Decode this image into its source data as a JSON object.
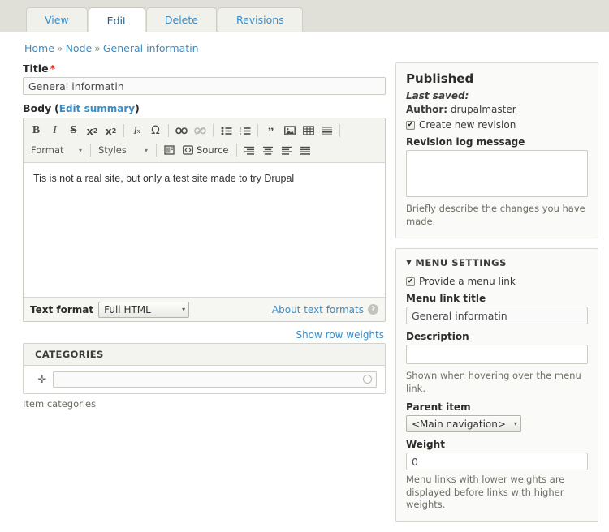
{
  "tabs": [
    {
      "label": "View",
      "active": false
    },
    {
      "label": "Edit",
      "active": true
    },
    {
      "label": "Delete",
      "active": false
    },
    {
      "label": "Revisions",
      "active": false
    }
  ],
  "breadcrumb": {
    "home": "Home",
    "node": "Node",
    "current": "General informatin",
    "separator": "»"
  },
  "form": {
    "title_label": "Title",
    "title_required_mark": "*",
    "title_value": "General informatin",
    "body_label": "Body",
    "body_edit_summary": "Edit summary",
    "body_paren_open": "(",
    "body_paren_close": ")",
    "body_text": "Tis is not a real site, but only a test site made to try Drupal"
  },
  "editor": {
    "format_dropdown": "Format",
    "styles_dropdown": "Styles",
    "source_label": "Source",
    "caret": "▾",
    "buttons_row1": [
      {
        "name": "bold-icon",
        "glyph": "B"
      },
      {
        "name": "italic-icon",
        "glyph": "I"
      },
      {
        "name": "strikethrough-icon",
        "glyph": "S"
      },
      {
        "name": "superscript-icon",
        "glyph": "x²"
      },
      {
        "name": "subscript-icon",
        "glyph": "x₂"
      },
      {
        "name": "remove-format-icon",
        "glyph": "Ix"
      },
      {
        "name": "special-character-icon",
        "glyph": "Ω"
      },
      {
        "name": "link-icon",
        "glyph": "link"
      },
      {
        "name": "unlink-icon",
        "glyph": "unlink"
      },
      {
        "name": "bulleted-list-icon",
        "glyph": "ul"
      },
      {
        "name": "numbered-list-icon",
        "glyph": "ol"
      },
      {
        "name": "blockquote-icon",
        "glyph": "”"
      },
      {
        "name": "image-icon",
        "glyph": "img"
      },
      {
        "name": "table-icon",
        "glyph": "tbl"
      },
      {
        "name": "horizontal-rule-icon",
        "glyph": "hr"
      }
    ],
    "buttons_row2": [
      {
        "name": "templates-icon",
        "glyph": "tpl"
      },
      {
        "name": "align-right-icon",
        "glyph": "ar"
      },
      {
        "name": "align-center-icon",
        "glyph": "ac"
      },
      {
        "name": "align-left-icon",
        "glyph": "al"
      },
      {
        "name": "justify-icon",
        "glyph": "aj"
      }
    ]
  },
  "textformat": {
    "label": "Text format",
    "value": "Full HTML",
    "caret": "▾",
    "about_link": "About text formats",
    "help_glyph": "?"
  },
  "rowweights": {
    "link": "Show row weights"
  },
  "categories": {
    "header": "CATEGORIES",
    "drag_glyph": "✛",
    "input_value": "",
    "description": "Item categories"
  },
  "sidebar": {
    "published": {
      "heading": "Published",
      "last_saved_label": "Last saved:",
      "last_saved_value": "",
      "author_label": "Author:",
      "author_value": "drupalmaster",
      "create_revision_label": "Create new revision",
      "create_revision_checked": true,
      "check_glyph": "✔",
      "revision_log_label": "Revision log message",
      "revision_log_value": "",
      "revision_hint": "Briefly describe the changes you have made."
    },
    "menu_settings": {
      "heading": "MENU SETTINGS",
      "collapse_glyph": "▼",
      "provide_menu_link_label": "Provide a menu link",
      "provide_menu_link_checked": true,
      "check_glyph": "✔",
      "menu_link_title_label": "Menu link title",
      "menu_link_title_value": "General informatin",
      "description_label": "Description",
      "description_value": "",
      "description_hint": "Shown when hovering over the menu link.",
      "parent_item_label": "Parent item",
      "parent_item_value": "<Main navigation>",
      "caret": "▾",
      "weight_label": "Weight",
      "weight_value": "0",
      "weight_hint": "Menu links with lower weights are displayed before links with higher weights."
    }
  }
}
